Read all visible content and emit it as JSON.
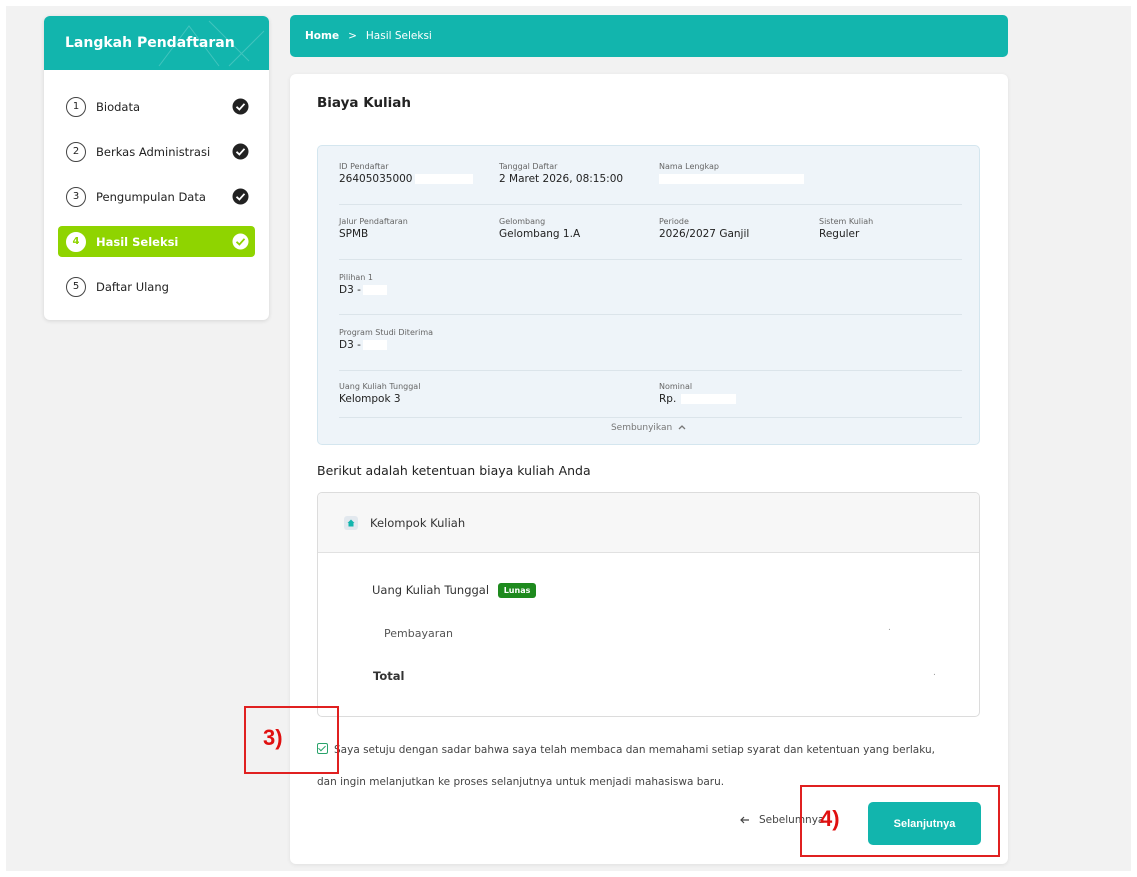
{
  "sidebar": {
    "title": "Langkah Pendaftaran",
    "steps": [
      {
        "num": "1",
        "label": "Biodata"
      },
      {
        "num": "2",
        "label": "Berkas Administrasi"
      },
      {
        "num": "3",
        "label": "Pengumpulan Data"
      },
      {
        "num": "4",
        "label": "Hasil Seleksi"
      },
      {
        "num": "5",
        "label": "Daftar Ulang"
      }
    ]
  },
  "breadcrumb": {
    "home": "Home",
    "separator": ">",
    "current": "Hasil Seleksi"
  },
  "main": {
    "title": "Biaya Kuliah",
    "fields": {
      "id": {
        "label": "ID Pendaftar",
        "value": "26405035000"
      },
      "tanggal": {
        "label": "Tanggal Daftar",
        "value": "2 Maret 2026, 08:15:00"
      },
      "nama": {
        "label": "Nama Lengkap",
        "value": ""
      },
      "jalur": {
        "label": "Jalur Pendaftaran",
        "value": "SPMB"
      },
      "gelombang": {
        "label": "Gelombang",
        "value": "Gelombang 1.A"
      },
      "periode": {
        "label": "Periode",
        "value": "2026/2027 Ganjil"
      },
      "sistem": {
        "label": "Sistem Kuliah",
        "value": "Reguler"
      },
      "pilihan": {
        "label": "Pilihan 1",
        "value": "D3 -"
      },
      "prodi": {
        "label": "Program Studi Diterima",
        "value": "D3 -"
      },
      "ukt": {
        "label": "Uang Kuliah Tunggal",
        "value": "Kelompok 3"
      },
      "nominal": {
        "label": "Nominal",
        "value": "Rp."
      }
    },
    "toggle_label": "Sembunyikan",
    "terms_title": "Berikut adalah ketentuan biaya kuliah Anda",
    "fee_box": {
      "header": "Kelompok Kuliah",
      "ukt_label": "Uang Kuliah Tunggal",
      "badge": "Lunas",
      "payment_label": "Pembayaran",
      "total_label": "Total",
      "payment_value": ".",
      "total_value": "."
    },
    "agreement_line1": "Saya setuju dengan sadar bahwa saya telah membaca dan memahami setiap syarat dan ketentuan yang berlaku,",
    "agreement_line2": "dan ingin melanjutkan ke proses selanjutnya untuk menjadi mahasiswa baru.",
    "prev_label": "Sebelumnya",
    "next_label": "Selanjutnya"
  },
  "annotations": {
    "label3": "3)",
    "label4": "4)"
  },
  "colors": {
    "primary": "#12b5ad",
    "active_step": "#8fd400",
    "badge": "#1e8a1e",
    "annotation": "#e02020"
  }
}
